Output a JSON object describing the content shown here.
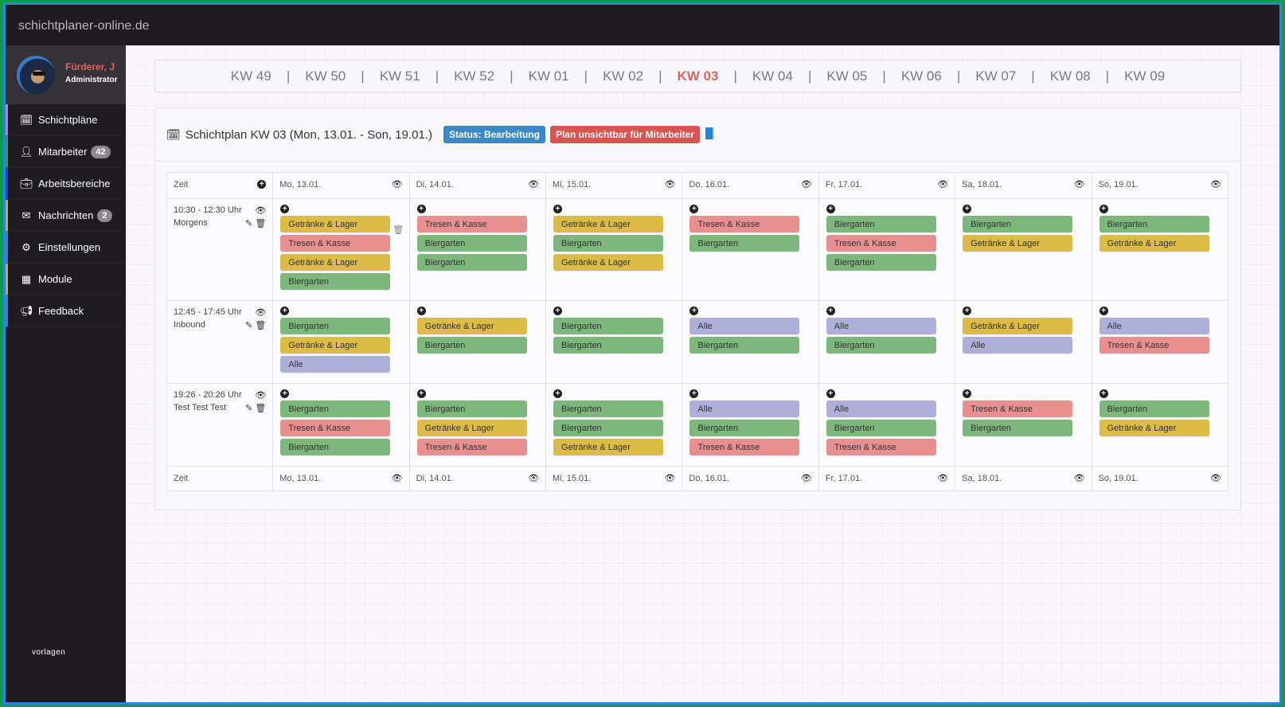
{
  "app": {
    "brand": "schichtplaner-online.de"
  },
  "profile": {
    "name": "Fürderer, J",
    "role": "Administrator"
  },
  "sidebar": {
    "items": [
      {
        "label": "Schichtpläne",
        "icon": "calendar-icon",
        "badge": null,
        "accent": "#c07bd0"
      },
      {
        "label": "Mitarbeiter",
        "icon": "user-icon",
        "badge": "42",
        "accent": "#1fa35a"
      },
      {
        "label": "Arbeitsbereiche",
        "icon": "briefcase-icon",
        "badge": null,
        "accent": "#2d3ee0"
      },
      {
        "label": "Nachrichten",
        "icon": "envelope-icon",
        "badge": "2",
        "accent": "#d3a43a"
      },
      {
        "label": "Einstellungen",
        "icon": "gear-icon",
        "badge": null,
        "accent": "#2a86d8"
      },
      {
        "label": "Module",
        "icon": "grid-icon",
        "badge": null,
        "accent": "#d3a43a"
      },
      {
        "label": "Feedback",
        "icon": "megaphone-icon",
        "badge": null,
        "accent": "#2a86d8"
      }
    ],
    "footer": "vorlagen"
  },
  "weeknav": {
    "weeks": [
      "KW 49",
      "KW 50",
      "KW 51",
      "KW 52",
      "KW 01",
      "KW 02",
      "KW 03",
      "KW 04",
      "KW 05",
      "KW 06",
      "KW 07",
      "KW 08",
      "KW 09"
    ],
    "active": "KW 03",
    "separator": "|"
  },
  "plan": {
    "title": "Schichtplan KW 03 (Mon, 13.01. - Son, 19.01.)",
    "status_label": "Status: Bearbeitung",
    "visibility_label": "Plan unsichtbar für Mitarbeiter",
    "time_header": "Zeit",
    "days": [
      "Mo, 13.01.",
      "Di, 14.01.",
      "Mi, 15.01.",
      "Do, 16.01.",
      "Fr, 17.01.",
      "Sa, 18.01.",
      "So, 19.01."
    ],
    "rows": [
      {
        "time": "10:30 - 12:30 Uhr",
        "name": "Morgens",
        "cells": [
          [
            "Getränke & Lager",
            "Tresen & Kasse",
            "Getränke & Lager",
            "Biergarten"
          ],
          [
            "Tresen & Kasse",
            "Biergarten",
            "Biergarten"
          ],
          [
            "Getränke & Lager",
            "Biergarten",
            "Getränke & Lager"
          ],
          [
            "Tresen & Kasse",
            "Biergarten"
          ],
          [
            "Biergarten",
            "Tresen & Kasse",
            "Biergarten"
          ],
          [
            "Biergarten",
            "Getränke & Lager"
          ],
          [
            "Biergarten",
            "Getränke & Lager"
          ]
        ]
      },
      {
        "time": "12:45 - 17:45 Uhr",
        "name": "Inbound",
        "cells": [
          [
            "Biergarten",
            "Getränke & Lager",
            "Alle"
          ],
          [
            "Getränke & Lager",
            "Biergarten"
          ],
          [
            "Biergarten",
            "Biergarten"
          ],
          [
            "Alle",
            "Biergarten"
          ],
          [
            "Alle",
            "Biergarten"
          ],
          [
            "Getränke & Lager",
            "Alle"
          ],
          [
            "Alle",
            "Tresen & Kasse"
          ]
        ]
      },
      {
        "time": "19:26 - 20:26 Uhr",
        "name": "Test Test Test",
        "cells": [
          [
            "Biergarten",
            "Tresen & Kasse",
            "Biergarten"
          ],
          [
            "Biergarten",
            "Getränke & Lager",
            "Tresen & Kasse"
          ],
          [
            "Biergarten",
            "Biergarten",
            "Getränke & Lager"
          ],
          [
            "Alle",
            "Biergarten",
            "Tresen & Kasse"
          ],
          [
            "Alle",
            "Biergarten",
            "Tresen & Kasse"
          ],
          [
            "Tresen & Kasse",
            "Biergarten"
          ],
          [
            "Biergarten",
            "Getränke & Lager"
          ]
        ]
      }
    ],
    "area_colors": {
      "Getränke & Lager": "#dcbc46",
      "Tresen & Kasse": "#e89090",
      "Biergarten": "#7db77c",
      "Alle": "#adb0d8"
    }
  },
  "colors": {
    "accent_active": "#e0655f",
    "status_blue": "#3c87c9",
    "danger_red": "#d9534f"
  }
}
